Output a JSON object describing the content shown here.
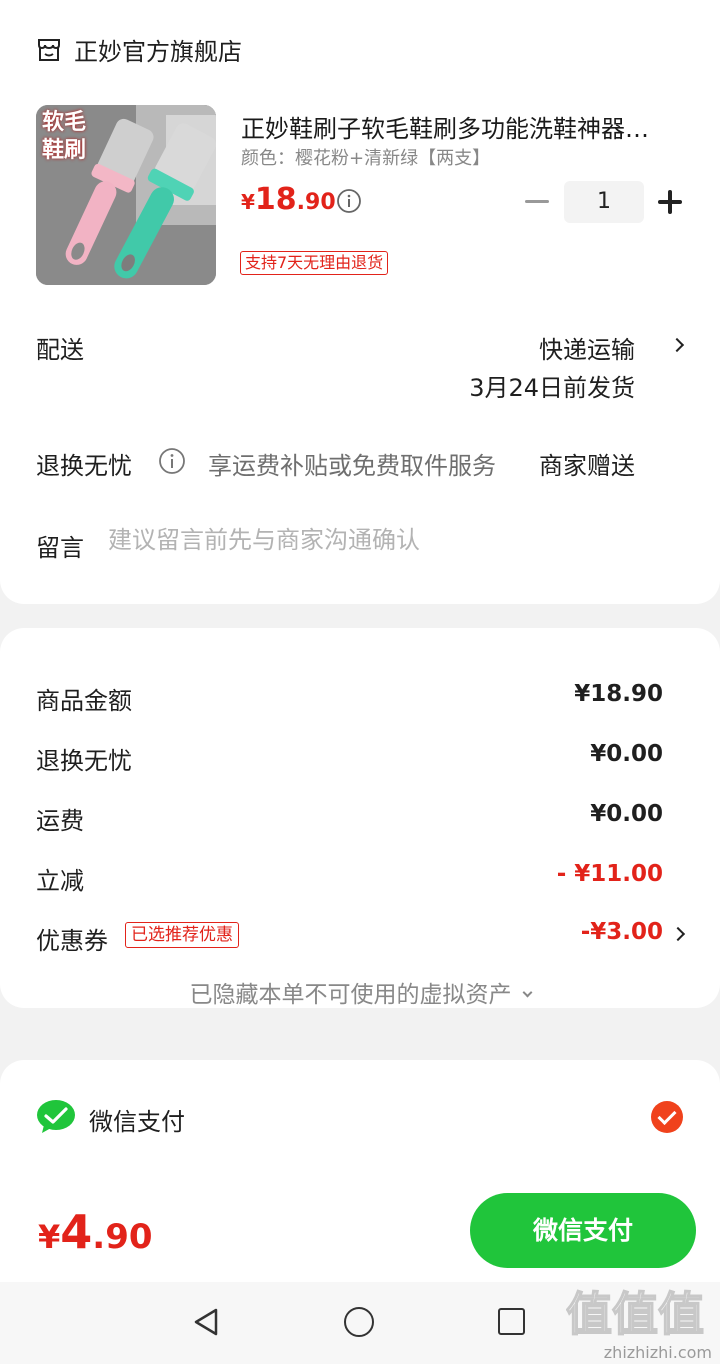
{
  "store": {
    "name": "正妙官方旗舰店",
    "icon": "store-icon"
  },
  "product": {
    "image_tag": "软毛鞋刷",
    "title": "正妙鞋刷子软毛鞋刷多功能洗鞋神器…",
    "spec": "颜色：樱花粉+清新绿【两支】",
    "price_currency": "¥",
    "price_int": "18",
    "price_dec": ".90",
    "quantity": "1",
    "return_badge": "支持7天无理由退货"
  },
  "delivery": {
    "label": "配送",
    "method": "快递运输",
    "date": "3月24日前发货"
  },
  "guarantee": {
    "label": "退换无忧",
    "desc": "享运费补贴或免费取件服务",
    "gift": "商家赠送"
  },
  "message": {
    "label": "留言",
    "placeholder": "建议留言前先与商家沟通确认"
  },
  "summary": {
    "goods_label": "商品金额",
    "goods_value": "¥18.90",
    "guarantee_label": "退换无忧",
    "guarantee_value": "¥0.00",
    "shipping_label": "运费",
    "shipping_value": "¥0.00",
    "discount_label": "立减",
    "discount_value": "- ¥11.00",
    "coupon_label": "优惠券",
    "coupon_badge": "已选推荐优惠",
    "coupon_value": "-¥3.00",
    "hidden_assets": "已隐藏本单不可使用的虚拟资产"
  },
  "payment": {
    "method": "微信支付",
    "selected": true,
    "accent": "#20c53b",
    "check_color": "#f0421c"
  },
  "footer": {
    "total_currency": "¥",
    "total_int": "4",
    "total_dec": ".90",
    "pay_button": "微信支付"
  },
  "watermark": {
    "text": "值值值",
    "site": "zhizhizhi.com"
  },
  "colors": {
    "price_red": "#e2231a",
    "wechat_green": "#20c53b",
    "background": "#f2f2f2"
  }
}
